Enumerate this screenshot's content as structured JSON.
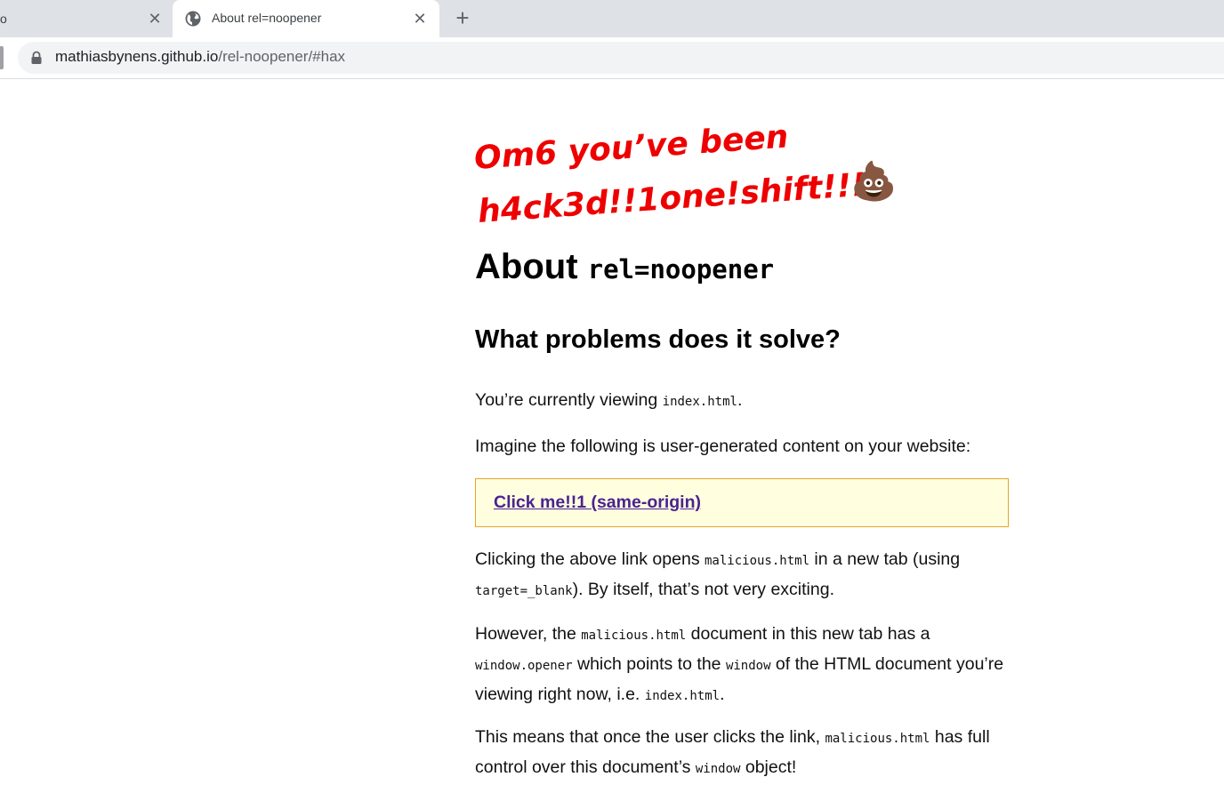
{
  "browser": {
    "inactive_tab_title": "o",
    "active_tab_title": "About rel=noopener",
    "close_glyph": "✕",
    "new_tab_glyph": "+",
    "url_host": "mathiasbynens.github.io",
    "url_path": "/rel-noopener/#hax"
  },
  "page": {
    "hacked_line1": "Om6 you’ve been",
    "hacked_line2": "h4ck3d!!1one!shift!!!1",
    "hacked_emoji": "💩",
    "h1_text": "About ",
    "h1_code": "rel=noopener",
    "h2": "What problems does it solve?",
    "p1": {
      "a": "You’re currently viewing ",
      "code": "index.html",
      "b": "."
    },
    "p2": "Imagine the following is user-generated content on your website:",
    "link": "Click me!!1 (same-origin)",
    "p3": {
      "a": "Clicking the above link opens ",
      "code1": "malicious.html",
      "b": " in a new tab (using ",
      "code2": "target=_blank",
      "c": "). By itself, that’s not very exciting."
    },
    "p4": {
      "a": "However, the ",
      "code1": "malicious.html",
      "b": " document in this new tab has a ",
      "code2": "window.opener",
      "c": " which points to the ",
      "code3": "window",
      "d": " of the HTML document you’re viewing right now, i.e. ",
      "code4": "index.html",
      "e": "."
    },
    "p5": {
      "a": "This means that once the user clicks the link, ",
      "code1": "malicious.html",
      "b": " has full control over this document’s ",
      "code2": "window",
      "c": " object!"
    }
  },
  "colors": {
    "tabstrip": "#dee1e6",
    "hacked_red": "#ee0000",
    "link_purple": "#4a2390",
    "box_bg": "#fffedf",
    "box_border": "#e6a52a"
  }
}
